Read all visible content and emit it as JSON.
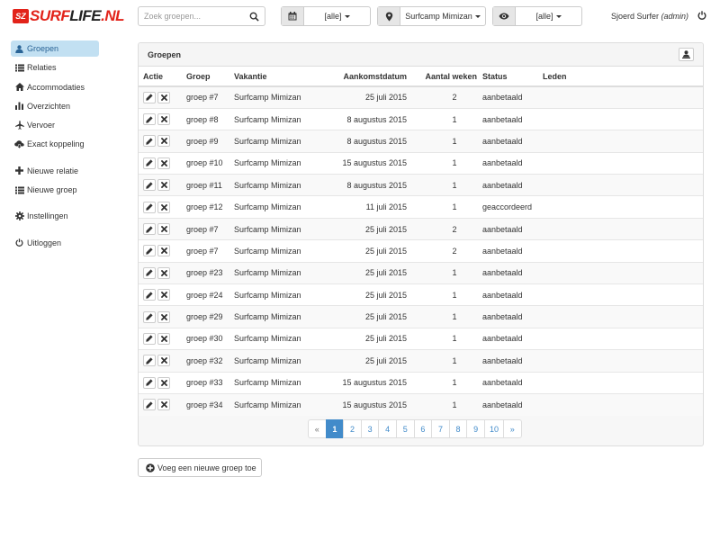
{
  "logo": {
    "mark": "SZ",
    "text_a": "SURF",
    "text_b": "LIFE",
    "text_c": ".NL"
  },
  "search": {
    "placeholder": "Zoek groepen..."
  },
  "filters": [
    {
      "icon": "calendar-icon",
      "value": "[alle]"
    },
    {
      "icon": "map-marker-icon",
      "value": "Surfcamp Mimizan"
    },
    {
      "icon": "eye-icon",
      "value": "[alle]"
    }
  ],
  "user": {
    "name": "Sjoerd Surfer",
    "role": "(admin)"
  },
  "sidebar": {
    "items": [
      {
        "label": "Groepen",
        "icon": "user-icon"
      },
      {
        "label": "Relaties",
        "icon": "list-icon"
      },
      {
        "label": "Accommodaties",
        "icon": "home-icon"
      },
      {
        "label": "Overzichten",
        "icon": "bar-chart-icon"
      },
      {
        "label": "Vervoer",
        "icon": "plane-icon"
      },
      {
        "label": "Exact koppeling",
        "icon": "cloud-download-icon"
      },
      {
        "label": "Nieuwe relatie",
        "icon": "plus-icon"
      },
      {
        "label": "Nieuwe groep",
        "icon": "list-icon"
      },
      {
        "label": "Instellingen",
        "icon": "cog-icon"
      },
      {
        "label": "Uitloggen",
        "icon": "power-icon"
      }
    ]
  },
  "panel": {
    "title": "Groepen"
  },
  "table": {
    "headers": {
      "actie": "Actie",
      "groep": "Groep",
      "vakantie": "Vakantie",
      "datum": "Aankomstdatum",
      "weken": "Aantal weken",
      "status": "Status",
      "leden": "Leden"
    },
    "rows": [
      {
        "groep": "groep #7",
        "vakantie": "Surfcamp Mimizan",
        "datum": "25 juli 2015",
        "weken": "2",
        "status": "aanbetaald"
      },
      {
        "groep": "groep #8",
        "vakantie": "Surfcamp Mimizan",
        "datum": "8 augustus 2015",
        "weken": "1",
        "status": "aanbetaald"
      },
      {
        "groep": "groep #9",
        "vakantie": "Surfcamp Mimizan",
        "datum": "8 augustus 2015",
        "weken": "1",
        "status": "aanbetaald"
      },
      {
        "groep": "groep #10",
        "vakantie": "Surfcamp Mimizan",
        "datum": "15 augustus 2015",
        "weken": "1",
        "status": "aanbetaald"
      },
      {
        "groep": "groep #11",
        "vakantie": "Surfcamp Mimizan",
        "datum": "8 augustus 2015",
        "weken": "1",
        "status": "aanbetaald"
      },
      {
        "groep": "groep #12",
        "vakantie": "Surfcamp Mimizan",
        "datum": "11 juli 2015",
        "weken": "1",
        "status": "geaccordeerd"
      },
      {
        "groep": "groep #7",
        "vakantie": "Surfcamp Mimizan",
        "datum": "25 juli 2015",
        "weken": "2",
        "status": "aanbetaald"
      },
      {
        "groep": "groep #7",
        "vakantie": "Surfcamp Mimizan",
        "datum": "25 juli 2015",
        "weken": "2",
        "status": "aanbetaald"
      },
      {
        "groep": "groep #23",
        "vakantie": "Surfcamp Mimizan",
        "datum": "25 juli 2015",
        "weken": "1",
        "status": "aanbetaald"
      },
      {
        "groep": "groep #24",
        "vakantie": "Surfcamp Mimizan",
        "datum": "25 juli 2015",
        "weken": "1",
        "status": "aanbetaald"
      },
      {
        "groep": "groep #29",
        "vakantie": "Surfcamp Mimizan",
        "datum": "25 juli 2015",
        "weken": "1",
        "status": "aanbetaald"
      },
      {
        "groep": "groep #30",
        "vakantie": "Surfcamp Mimizan",
        "datum": "25 juli 2015",
        "weken": "1",
        "status": "aanbetaald"
      },
      {
        "groep": "groep #32",
        "vakantie": "Surfcamp Mimizan",
        "datum": "25 juli 2015",
        "weken": "1",
        "status": "aanbetaald"
      },
      {
        "groep": "groep #33",
        "vakantie": "Surfcamp Mimizan",
        "datum": "15 augustus 2015",
        "weken": "1",
        "status": "aanbetaald"
      },
      {
        "groep": "groep #34",
        "vakantie": "Surfcamp Mimizan",
        "datum": "15 augustus 2015",
        "weken": "1",
        "status": "aanbetaald"
      }
    ]
  },
  "pagination": {
    "prev": "«",
    "pages": [
      "1",
      "2",
      "3",
      "4",
      "5",
      "6",
      "7",
      "8",
      "9",
      "10"
    ],
    "next": "»",
    "active": "1"
  },
  "add_button": {
    "label": "Voeg een nieuwe groep toe"
  },
  "colors": {
    "brand": "#e2231a",
    "accent": "#428bca",
    "active_nav": "#c2e0f2"
  }
}
